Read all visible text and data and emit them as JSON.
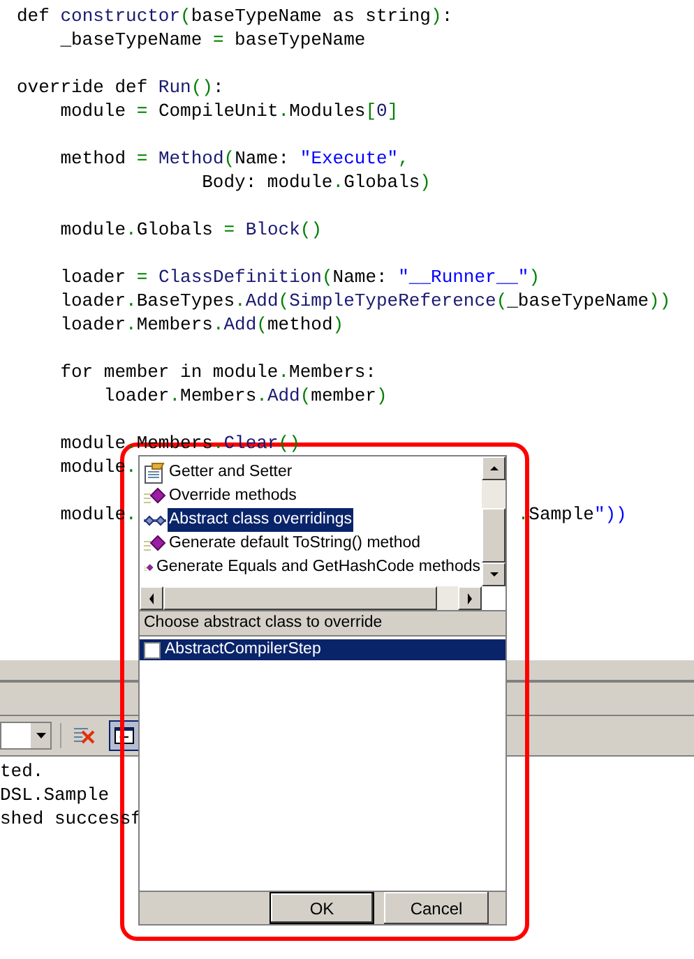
{
  "code_blocks": [
    [
      "def constructor(baseTypeName as string):",
      "    _baseTypeName = baseTypeName"
    ],
    [
      "override def Run():",
      "    module = CompileUnit.Modules[0]"
    ],
    [
      "    method = Method(Name: \"Execute\",",
      "                 Body: module.Globals)"
    ],
    [
      "    module.Globals = Block()"
    ],
    [
      "    loader = ClassDefinition(Name: \"__Runner__\")",
      "    loader.BaseTypes.Add(SimpleTypeReference(_baseTypeName))",
      "    loader.Members.Add(method)"
    ],
    [
      "    for member in module.Members:",
      "        loader.Members.Add(member)"
    ],
    [
      "    module.Members.Clear()",
      "    module."
    ],
    [
      "    module."
    ]
  ],
  "code_tail": ".Sample\"))",
  "output_panel": {
    "toggle_on": true,
    "lines": [
      "ted.",
      "DSL.Sample",
      "shed successf"
    ]
  },
  "dialog": {
    "items": [
      {
        "label": "Getter and Setter",
        "kind": "property",
        "selected": false
      },
      {
        "label": "Override methods",
        "kind": "method",
        "selected": false
      },
      {
        "label": "Abstract class overridings",
        "kind": "class",
        "selected": true
      },
      {
        "label": "Generate default ToString() method",
        "kind": "method",
        "selected": false
      },
      {
        "label": "Generate Equals and GetHashCode methods",
        "kind": "method",
        "selected": false
      }
    ],
    "section_label": "Choose abstract class to override",
    "classes": [
      {
        "label": "AbstractCompilerStep",
        "checked": false,
        "selected": true
      }
    ],
    "buttons": [
      "OK",
      "Cancel"
    ]
  }
}
